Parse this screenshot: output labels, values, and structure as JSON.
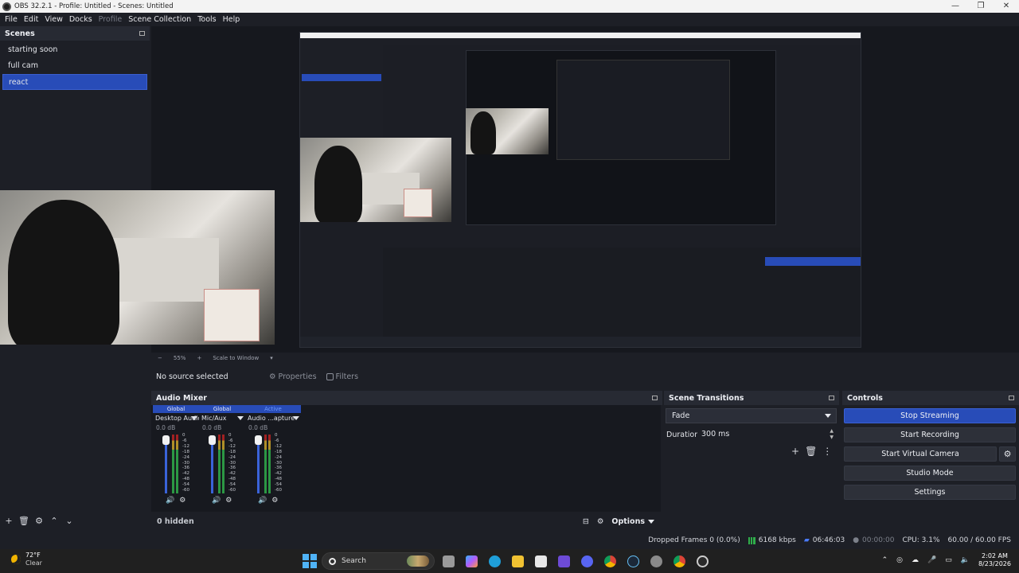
{
  "window": {
    "title": "OBS 32.2.1 - Profile: Untitled - Scenes: Untitled",
    "controls": [
      "—",
      "❐",
      "✕"
    ]
  },
  "menu": [
    "File",
    "Edit",
    "View",
    "Docks",
    "Profile",
    "Scene Collection",
    "Tools",
    "Help"
  ],
  "scenes": {
    "title": "Scenes",
    "items": [
      "starting soon",
      "full cam",
      "react"
    ],
    "active_index": 2
  },
  "preview": {
    "zoom": "55%",
    "scale_mode": "Scale to Window"
  },
  "properties_bar": {
    "no_source": "No source selected",
    "properties_label": "Properties",
    "filters_label": "Filters"
  },
  "audio_mixer": {
    "title": "Audio Mixer",
    "channels": [
      {
        "tag": "Global",
        "name": "Desktop Audio",
        "db": "0.0 dB",
        "level": 0.74
      },
      {
        "tag": "Global",
        "name": "Mic/Aux",
        "db": "0.0 dB",
        "level": 0.74
      },
      {
        "tag": "Active",
        "name": "Audio ...apture",
        "db": "0.0 dB",
        "level": 0.74
      }
    ],
    "scale": [
      "0",
      "-6",
      "-12",
      "-18",
      "-24",
      "-30",
      "-36",
      "-42",
      "-48",
      "-54",
      "-60"
    ],
    "hidden_label": "0 hidden",
    "options_label": "Options"
  },
  "scene_transitions": {
    "title": "Scene Transitions",
    "transition": "Fade",
    "duration_label": "Duration",
    "duration_value": "300 ms"
  },
  "controls": {
    "title": "Controls",
    "stop_streaming": "Stop Streaming",
    "start_recording": "Start Recording",
    "start_virtual_camera": "Start Virtual Camera",
    "studio_mode": "Studio Mode",
    "settings": "Settings"
  },
  "status": {
    "dropped_frames": "Dropped Frames 0 (0.0%)",
    "bitrate": "6168 kbps",
    "stream_time": "06:46:03",
    "record_time": "00:00:00",
    "cpu": "CPU: 3.1%",
    "fps": "60.00 / 60.00 FPS"
  },
  "taskbar": {
    "temp": "72°F",
    "condition": "Clear",
    "search_placeholder": "Search",
    "time": "2:02 AM",
    "date": "8/23/2026"
  },
  "colors": {
    "accent": "#284cb8",
    "background": "#1d1f26"
  }
}
